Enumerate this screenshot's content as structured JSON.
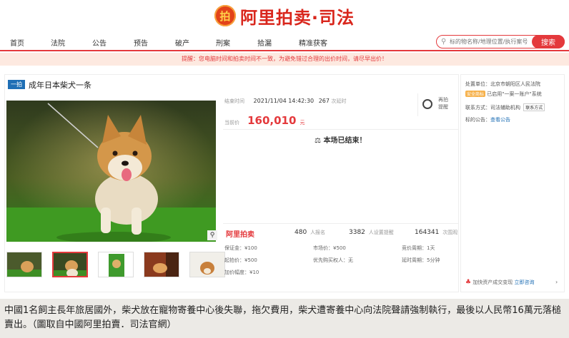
{
  "header": {
    "logo_emblem": "拍",
    "logo_text": "阿里拍卖·司法"
  },
  "nav": {
    "items": [
      "首页",
      "法院",
      "公告",
      "预告",
      "破产",
      "刑案",
      "拾漏",
      "精准获客"
    ],
    "search_placeholder": "标的物名称/地理位置/执行案号",
    "search_button": "搜索"
  },
  "notice": "提醒：您电脑时间和拍卖时间不一致，为避免错过合理的出价时间，请尽早出价！",
  "item": {
    "badge": "一拍",
    "title": "成年日本柴犬一条",
    "end_label": "结束时间",
    "end_time": "2021/11/04 14:42:30",
    "delay_count": "267",
    "delay_label": "次延时",
    "price_label": "当前价",
    "price": "160,010",
    "price_unit": "元",
    "remind_label": "再拍提醒",
    "ended_text": "本场已结束！",
    "stats_logo": "阿里拍卖",
    "stats": [
      {
        "value": "480",
        "label": "人报名"
      },
      {
        "value": "3382",
        "label": "人设置提醒"
      },
      {
        "value": "164341",
        "label": "次围观"
      }
    ],
    "details": [
      [
        "保证金：¥100",
        "市场价：¥500",
        "竞价周期：1天"
      ],
      [
        "起拍价：¥500",
        "优先购买权人：无",
        "延时周期：5分钟"
      ],
      [
        "加价幅度：¥10",
        "",
        ""
      ]
    ]
  },
  "side": {
    "unit_label": "处置单位：",
    "unit_value": "北京市朝阳区人民法院",
    "safe_badge": "安全商标",
    "safe_text": "已启用\"一案一账户\"系统",
    "contact_label": "联系方式：司法辅助机构",
    "contact_button": "联系方式",
    "notice_label": "标的公告：",
    "notice_link": "查看公告",
    "consult_text": "加快资产成交变现",
    "consult_link": "立即咨询"
  },
  "caption": "中國1名飼主長年旅居國外，柴犬放在寵物寄養中心後失聯，拖欠費用，柴犬遭寄養中心向法院聲請強制執行，最後以人民幣16萬元落槌賣出。（圖取自中國阿里拍賣．司法官網）"
}
